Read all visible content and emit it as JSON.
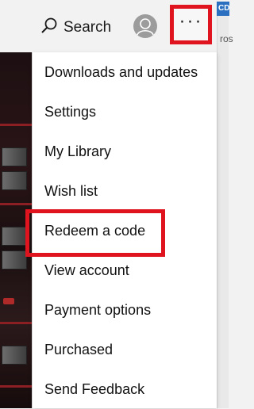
{
  "header": {
    "search_label": "Search",
    "more_label": "···"
  },
  "edge": {
    "badge": "CD",
    "text": "ros"
  },
  "menu": {
    "items": [
      {
        "label": "Downloads and updates"
      },
      {
        "label": "Settings"
      },
      {
        "label": "My Library"
      },
      {
        "label": "Wish list"
      },
      {
        "label": "Redeem a code"
      },
      {
        "label": "View account"
      },
      {
        "label": "Payment options"
      },
      {
        "label": "Purchased"
      },
      {
        "label": "Send Feedback"
      }
    ]
  },
  "colors": {
    "highlight": "#e0141e",
    "menu_bg": "#ffffff",
    "bar_bg": "#f2f2f2"
  }
}
